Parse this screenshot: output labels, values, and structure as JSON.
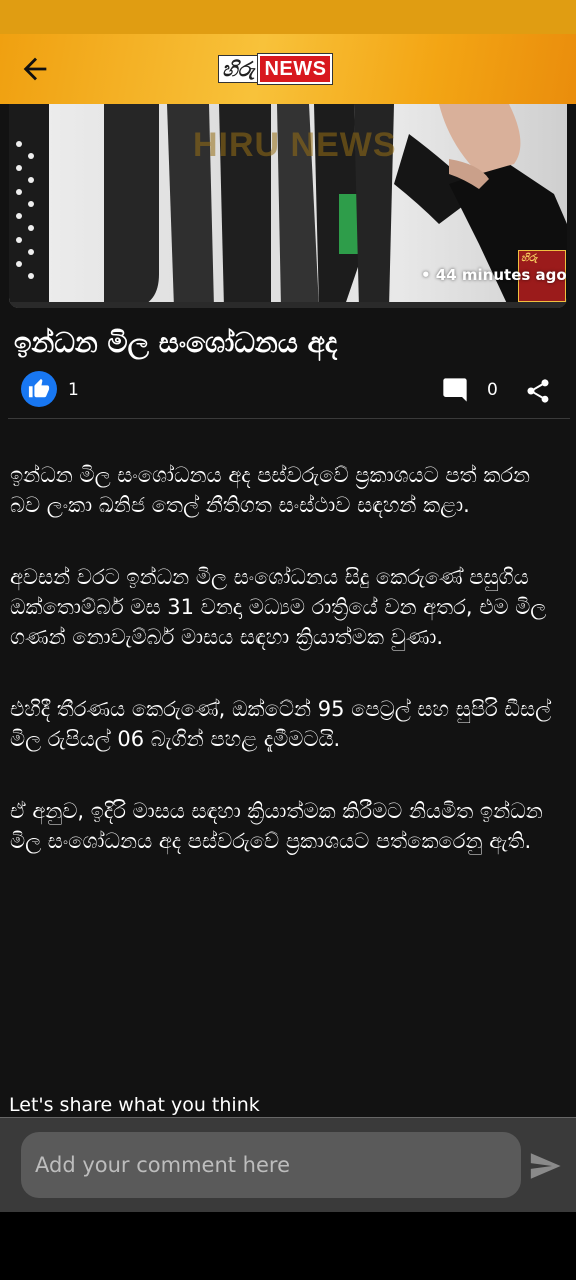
{
  "header": {
    "logo_left": "හිරු",
    "logo_right": "NEWS"
  },
  "hero": {
    "watermark": "HIRU NEWS",
    "time_ago": "• 44 minutes ago"
  },
  "article": {
    "title": "ඉන්ධන මිල සංශෝධනය අද",
    "likes": "1",
    "comments": "0",
    "paragraphs": [
      "ඉන්ධන මිල සංශෝධනය අද පස්වරුවේ ප්‍රකාශයට පත් කරන බව ලංකා ඛනිජ තෙල් නීතිගත සංස්ථාව සඳහන් කළා.",
      "අවසන් වරට ඉන්ධන මිල සංශෝධනය සිදු කෙරුණේ පසුගිය ඔක්තොම්බර් මස 31 වනදා මධ්‍යම රාත්‍රියේ වන අතර, එම මිල ගණන් නොවැම්බර් මාසය සඳහා ක්‍රියාත්මක වුණා.",
      "එහිදී තීරණය කෙරුණේ, ඔක්ටේන් 95 පෙට්‍රල් සහ සුපිරි ඩීසල් මිල රුපියල් 06 බැගින් පහළ දැමීමටයි.",
      "ඒ අනුව, ඉදිරි මාසය සඳහා ක්‍රියාත්මක කිරීමට නියමිත ඉන්ධන මිල සංශෝධනය අද පස්වරුවේ ප්‍රකාශයට පත්කෙරෙනු ඇති."
    ]
  },
  "comment": {
    "prompt": "Let's share what you think",
    "placeholder": "Add your comment here"
  },
  "colors": {
    "header_accent": "#f3a514",
    "like_blue": "#1877f2",
    "background": "#121212"
  },
  "icons": [
    "back-arrow-icon",
    "thumbs-up-icon",
    "comment-icon",
    "share-icon",
    "send-icon"
  ]
}
